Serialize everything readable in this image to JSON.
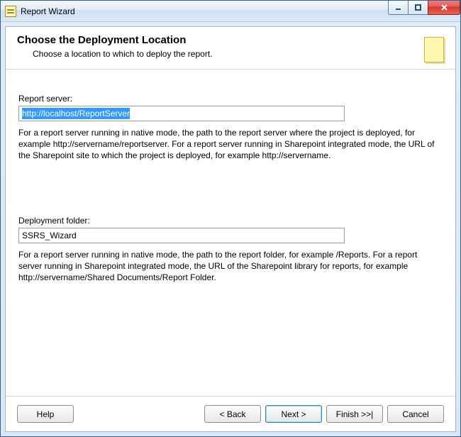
{
  "window": {
    "title": "Report Wizard"
  },
  "header": {
    "title": "Choose the Deployment Location",
    "subtitle": "Choose a location to which to deploy the report."
  },
  "form": {
    "reportServer": {
      "label": "Report server:",
      "value": "http://localhost/ReportServer",
      "help": "For a report server running in native mode, the path to the report server where the project is deployed, for example http://servername/reportserver.  For a report server running in Sharepoint integrated mode, the URL of the Sharepoint site to which the project is deployed, for example http://servername."
    },
    "deploymentFolder": {
      "label": "Deployment folder:",
      "value": "SSRS_Wizard",
      "help": "For a report server running in native mode, the path to the report folder, for example /Reports.  For a report server running in Sharepoint integrated mode, the URL of the Sharepoint library for reports, for example http://servername/Shared Documents/Report Folder."
    }
  },
  "buttons": {
    "help": "Help",
    "back": "< Back",
    "next": "Next >",
    "finish": "Finish >>|",
    "cancel": "Cancel"
  }
}
